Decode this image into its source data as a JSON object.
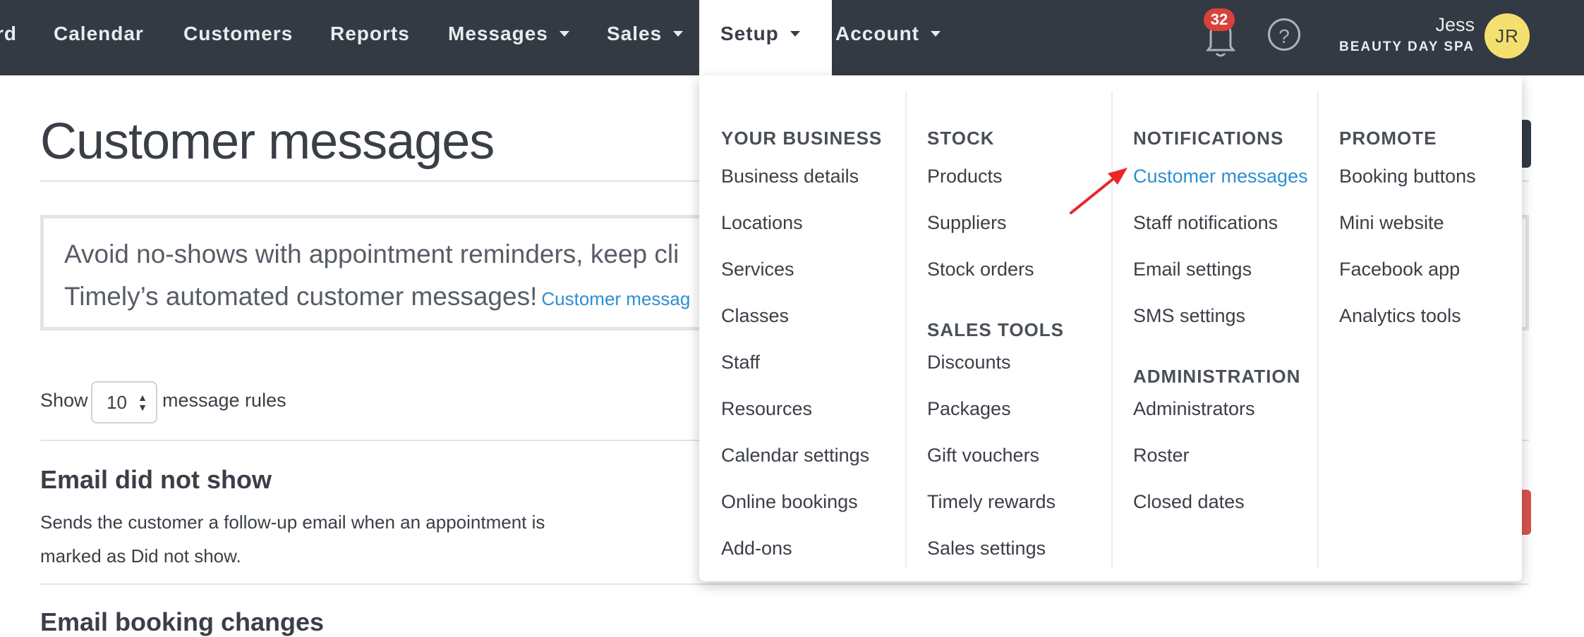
{
  "nav": {
    "items": [
      {
        "label": "rd"
      },
      {
        "label": "Calendar"
      },
      {
        "label": "Customers"
      },
      {
        "label": "Reports"
      },
      {
        "label": "Messages"
      },
      {
        "label": "Sales"
      },
      {
        "label": "Setup"
      },
      {
        "label": "Account"
      }
    ],
    "notifications_count": "32",
    "help_glyph": "?",
    "user_name": "Jess",
    "business_name": "BEAUTY DAY SPA",
    "avatar_initials": "JR"
  },
  "page": {
    "title": "Customer messages",
    "info_line1": "Avoid no-shows with appointment reminders, keep cli",
    "info_line2": "Timely’s automated customer messages!",
    "info_link": "Customer messag",
    "show_label": "Show",
    "show_value": "10",
    "rules_label": "message rules",
    "rules": [
      {
        "title": "Email did not show",
        "desc_line1": "Sends the customer a follow-up email when an appointment is",
        "desc_line2": "marked as Did not show."
      },
      {
        "title": "Email booking changes"
      }
    ]
  },
  "setup_menu": {
    "columns": [
      {
        "sections": [
          {
            "heading": "YOUR BUSINESS",
            "items": [
              "Business details",
              "Locations",
              "Services",
              "Classes",
              "Staff",
              "Resources",
              "Calendar settings",
              "Online bookings",
              "Add-ons"
            ]
          }
        ]
      },
      {
        "sections": [
          {
            "heading": "STOCK",
            "items": [
              "Products",
              "Suppliers",
              "Stock orders"
            ]
          },
          {
            "heading": "SALES TOOLS",
            "items": [
              "Discounts",
              "Packages",
              "Gift vouchers",
              "Timely rewards",
              "Sales settings"
            ]
          }
        ]
      },
      {
        "sections": [
          {
            "heading": "NOTIFICATIONS",
            "items": [
              "Customer messages",
              "Staff notifications",
              "Email settings",
              "SMS settings"
            ]
          },
          {
            "heading": "ADMINISTRATION",
            "items": [
              "Administrators",
              "Roster",
              "Closed dates"
            ]
          }
        ]
      },
      {
        "sections": [
          {
            "heading": "PROMOTE",
            "items": [
              "Booking buttons",
              "Mini website",
              "Facebook app",
              "Analytics tools"
            ]
          }
        ]
      }
    ],
    "current_item": "Customer messages"
  },
  "colors": {
    "nav_bg": "#343a43",
    "link_blue": "#2d8fd0",
    "badge_red": "#d9413a",
    "avatar_yellow": "#f4e06e",
    "annotation_arrow": "#e8262a"
  }
}
